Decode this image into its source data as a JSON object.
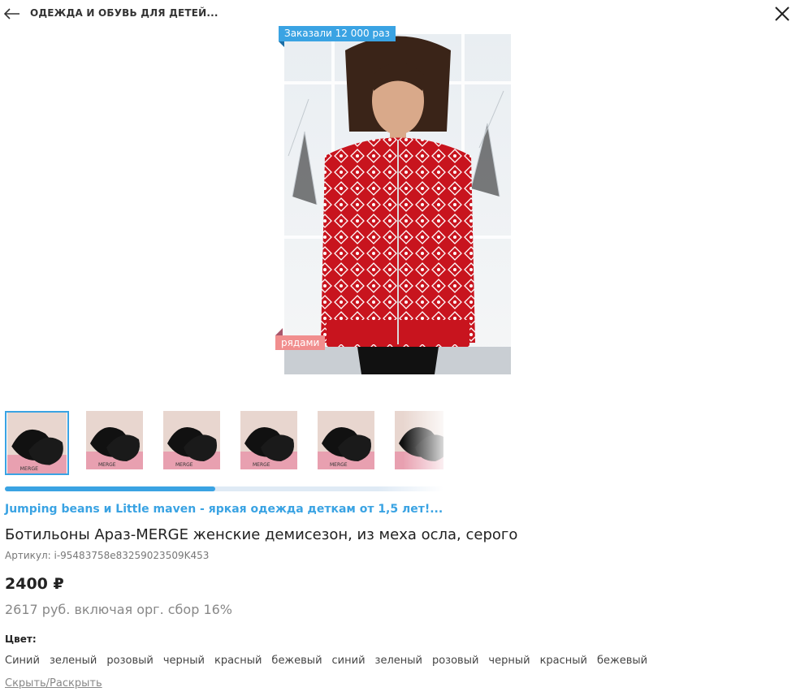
{
  "header": {
    "back_icon": "arrow-left-icon",
    "breadcrumb": "ОДЕЖДА И ОБУВЬ ДЛЯ ДЕТЕЙ...",
    "close_icon": "close-icon"
  },
  "product": {
    "badge_top": "Заказали 12 000 раз",
    "badge_bottom": "рядами",
    "shop_link": "Jumping beans и Little maven - яркая одежда деткам от 1,5 лет!...",
    "title": "Ботильоны Араз-MERGE женские демисезон, из меха осла, серого",
    "article": "Артикул: i-95483758e83259023509K453",
    "price": "2400 ₽",
    "price_note": "2617 руб. включая орг. сбор 16%",
    "color_label": "Цвет:",
    "colors": [
      "Синий",
      "зеленый",
      "розовый",
      "черный",
      "красный",
      "бежевый",
      "синий",
      "зеленый",
      "розовый",
      "черный",
      "красный",
      "бежевый"
    ],
    "toggle_label": "Скрыть/Раскрыть"
  },
  "gallery": {
    "thumb_count": 6,
    "active_index": 0,
    "scroll_fraction": 0.48,
    "accent": "#3aa3e3"
  }
}
